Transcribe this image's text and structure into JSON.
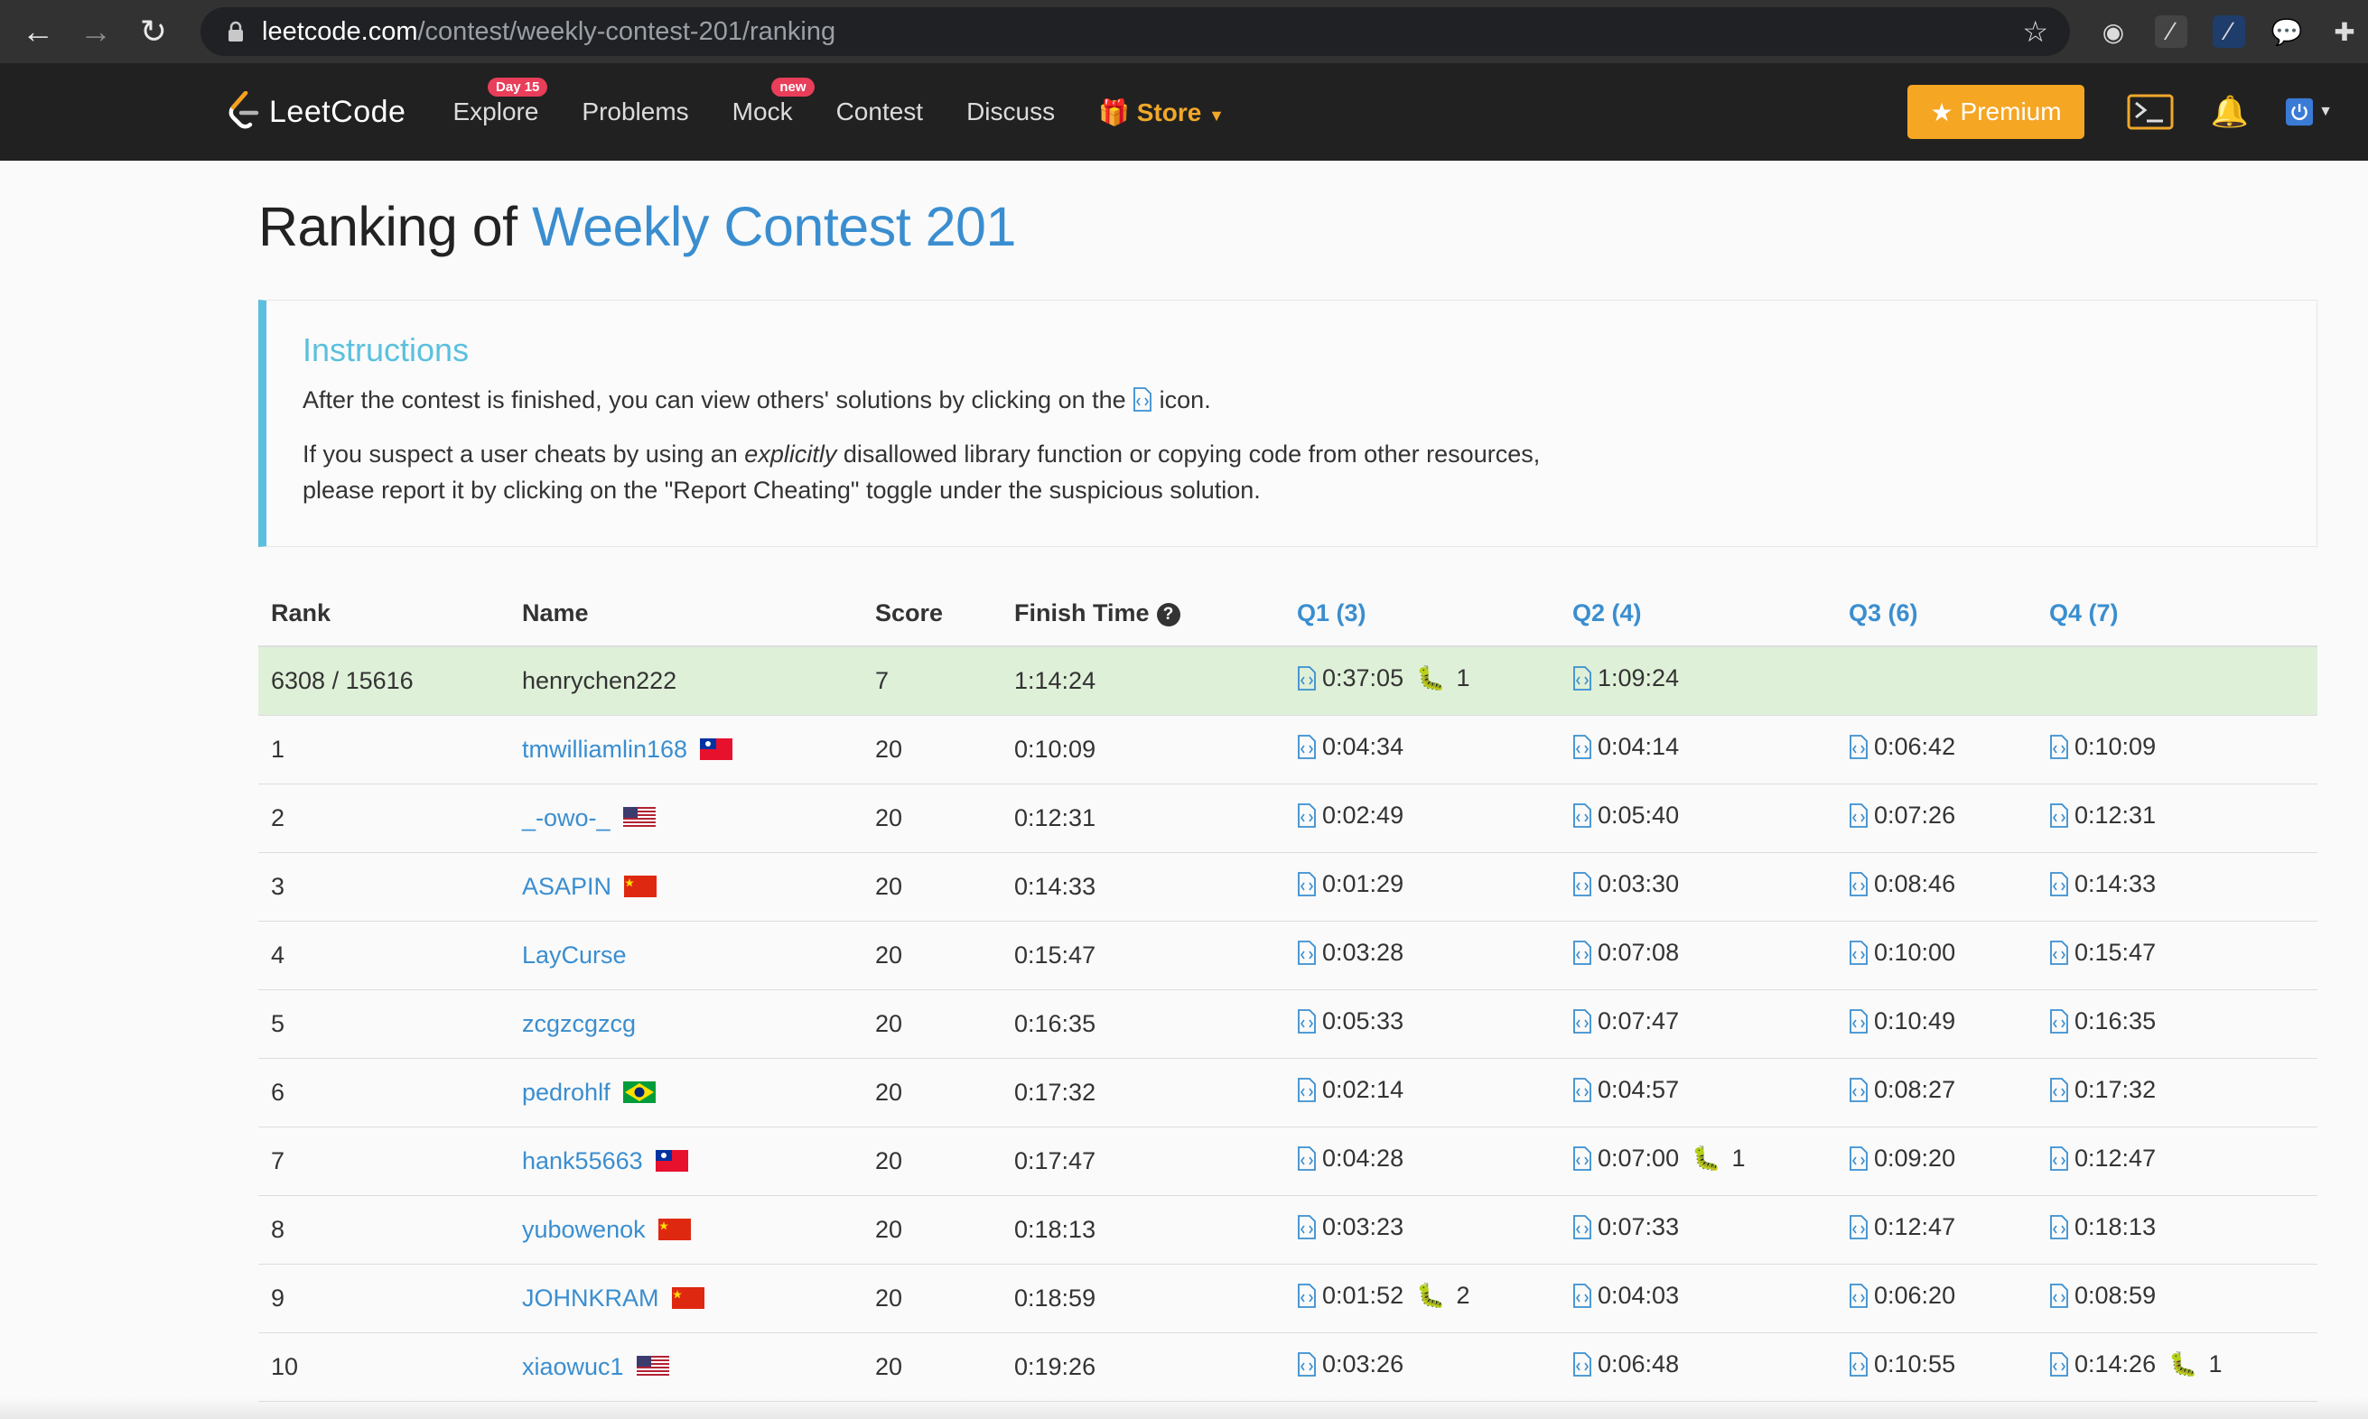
{
  "browser": {
    "url_host": "leetcode.com",
    "url_path": "/contest/weekly-contest-201/ranking"
  },
  "nav": {
    "logo_text": "LeetCode",
    "items": [
      {
        "label": "Explore",
        "badge": "Day 15"
      },
      {
        "label": "Problems",
        "badge": ""
      },
      {
        "label": "Mock",
        "badge": "new"
      },
      {
        "label": "Contest",
        "badge": ""
      },
      {
        "label": "Discuss",
        "badge": ""
      }
    ],
    "store_label": "Store",
    "premium_label": "Premium"
  },
  "page": {
    "title_prefix": "Ranking of",
    "title_contest": "Weekly Contest 201"
  },
  "instructions": {
    "heading": "Instructions",
    "line1_before": "After the contest is finished, you can view others' solutions by clicking on the",
    "line1_after": "icon.",
    "line2_part1": "If you suspect a user cheats by using an",
    "line2_em": "explicitly",
    "line2_part2": "disallowed library function or copying code from other resources,",
    "line2_part3": "please report it by clicking on the \"Report Cheating\" toggle under the suspicious solution."
  },
  "table": {
    "headers": {
      "rank": "Rank",
      "name": "Name",
      "score": "Score",
      "finish": "Finish Time",
      "q1": "Q1 (3)",
      "q2": "Q2 (4)",
      "q3": "Q3 (6)",
      "q4": "Q4 (7)"
    },
    "rows": [
      {
        "rank": "6308 / 15616",
        "name": "henrychen222",
        "flag": "",
        "score": "7",
        "finish": "1:14:24",
        "q": [
          {
            "t": "0:37:05",
            "bugs": "1"
          },
          {
            "t": "1:09:24",
            "bugs": ""
          },
          {
            "t": "",
            "bugs": ""
          },
          {
            "t": "",
            "bugs": ""
          }
        ]
      },
      {
        "rank": "1",
        "name": "tmwilliamlin168",
        "flag": "tw",
        "score": "20",
        "finish": "0:10:09",
        "q": [
          {
            "t": "0:04:34",
            "bugs": ""
          },
          {
            "t": "0:04:14",
            "bugs": ""
          },
          {
            "t": "0:06:42",
            "bugs": ""
          },
          {
            "t": "0:10:09",
            "bugs": ""
          }
        ]
      },
      {
        "rank": "2",
        "name": "_-owo-_",
        "flag": "us",
        "score": "20",
        "finish": "0:12:31",
        "q": [
          {
            "t": "0:02:49",
            "bugs": ""
          },
          {
            "t": "0:05:40",
            "bugs": ""
          },
          {
            "t": "0:07:26",
            "bugs": ""
          },
          {
            "t": "0:12:31",
            "bugs": ""
          }
        ]
      },
      {
        "rank": "3",
        "name": "ASAPIN",
        "flag": "cn",
        "score": "20",
        "finish": "0:14:33",
        "q": [
          {
            "t": "0:01:29",
            "bugs": ""
          },
          {
            "t": "0:03:30",
            "bugs": ""
          },
          {
            "t": "0:08:46",
            "bugs": ""
          },
          {
            "t": "0:14:33",
            "bugs": ""
          }
        ]
      },
      {
        "rank": "4",
        "name": "LayCurse",
        "flag": "",
        "score": "20",
        "finish": "0:15:47",
        "q": [
          {
            "t": "0:03:28",
            "bugs": ""
          },
          {
            "t": "0:07:08",
            "bugs": ""
          },
          {
            "t": "0:10:00",
            "bugs": ""
          },
          {
            "t": "0:15:47",
            "bugs": ""
          }
        ]
      },
      {
        "rank": "5",
        "name": "zcgzcgzcg",
        "flag": "",
        "score": "20",
        "finish": "0:16:35",
        "q": [
          {
            "t": "0:05:33",
            "bugs": ""
          },
          {
            "t": "0:07:47",
            "bugs": ""
          },
          {
            "t": "0:10:49",
            "bugs": ""
          },
          {
            "t": "0:16:35",
            "bugs": ""
          }
        ]
      },
      {
        "rank": "6",
        "name": "pedrohlf",
        "flag": "br",
        "score": "20",
        "finish": "0:17:32",
        "q": [
          {
            "t": "0:02:14",
            "bugs": ""
          },
          {
            "t": "0:04:57",
            "bugs": ""
          },
          {
            "t": "0:08:27",
            "bugs": ""
          },
          {
            "t": "0:17:32",
            "bugs": ""
          }
        ]
      },
      {
        "rank": "7",
        "name": "hank55663",
        "flag": "tw",
        "score": "20",
        "finish": "0:17:47",
        "q": [
          {
            "t": "0:04:28",
            "bugs": ""
          },
          {
            "t": "0:07:00",
            "bugs": "1"
          },
          {
            "t": "0:09:20",
            "bugs": ""
          },
          {
            "t": "0:12:47",
            "bugs": ""
          }
        ]
      },
      {
        "rank": "8",
        "name": "yubowenok",
        "flag": "cn",
        "score": "20",
        "finish": "0:18:13",
        "q": [
          {
            "t": "0:03:23",
            "bugs": ""
          },
          {
            "t": "0:07:33",
            "bugs": ""
          },
          {
            "t": "0:12:47",
            "bugs": ""
          },
          {
            "t": "0:18:13",
            "bugs": ""
          }
        ]
      },
      {
        "rank": "9",
        "name": "JOHNKRAM",
        "flag": "cn",
        "score": "20",
        "finish": "0:18:59",
        "q": [
          {
            "t": "0:01:52",
            "bugs": "2"
          },
          {
            "t": "0:04:03",
            "bugs": ""
          },
          {
            "t": "0:06:20",
            "bugs": ""
          },
          {
            "t": "0:08:59",
            "bugs": ""
          }
        ]
      },
      {
        "rank": "10",
        "name": "xiaowuc1",
        "flag": "us",
        "score": "20",
        "finish": "0:19:26",
        "q": [
          {
            "t": "0:03:26",
            "bugs": ""
          },
          {
            "t": "0:06:48",
            "bugs": ""
          },
          {
            "t": "0:10:55",
            "bugs": ""
          },
          {
            "t": "0:14:26",
            "bugs": "1"
          }
        ]
      }
    ]
  },
  "colors": {
    "nav_bg": "#212121",
    "accent_blue": "#3a8ed0",
    "premium": "#f5a623",
    "store": "#f0a82a",
    "highlight_row": "#dff0d8",
    "instructions_border": "#5bc0de",
    "bug": "#c0392b"
  }
}
